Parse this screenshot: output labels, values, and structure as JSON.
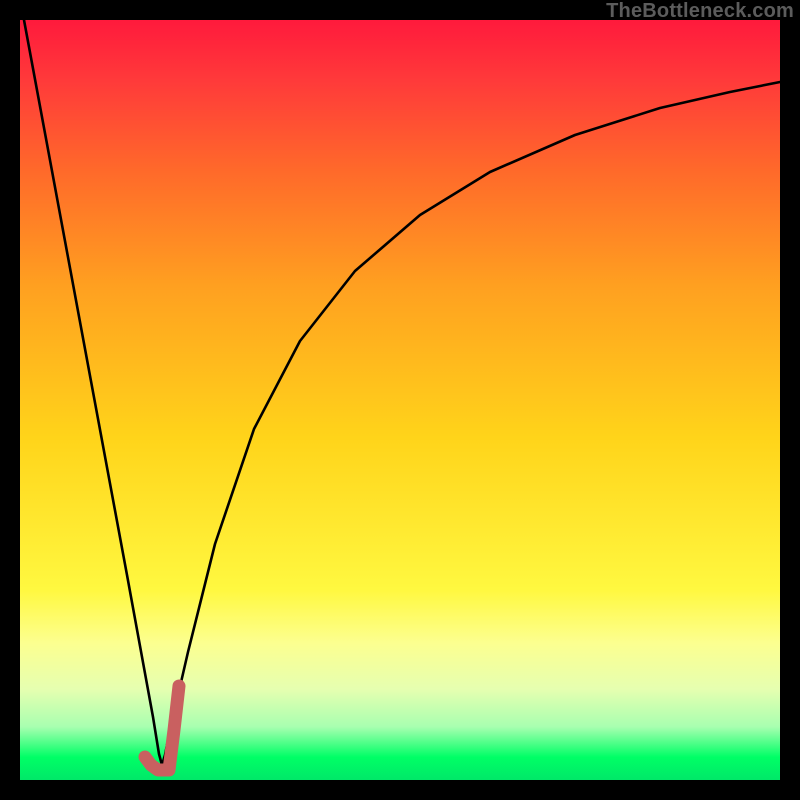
{
  "watermark": {
    "text": "TheBottleneck.com"
  },
  "chart_data": {
    "type": "line",
    "title": "",
    "xlabel": "",
    "ylabel": "",
    "xlim": [
      0,
      100
    ],
    "ylim": [
      0,
      100
    ],
    "grid": false,
    "legend": null,
    "x": [
      0,
      5,
      10,
      15,
      18,
      20,
      22,
      25,
      30,
      35,
      40,
      45,
      50,
      55,
      60,
      70,
      80,
      90,
      100
    ],
    "series": [
      {
        "name": "bottleneck-curve",
        "values": [
          100,
          70,
          41,
          12,
          0,
          6,
          18,
          32,
          47,
          58,
          66,
          72,
          77,
          81,
          84,
          88,
          91,
          92.5,
          93
        ]
      }
    ],
    "highlight": {
      "name": "optimal-region",
      "x": [
        16.4,
        17.2,
        18.2,
        19.6,
        20.3,
        20.9
      ],
      "values": [
        3,
        2,
        1.2,
        1.2,
        6,
        12
      ]
    },
    "background_gradient": {
      "top": "#ff1a3c",
      "middle": "#ffd41a",
      "bottom": "#00e868"
    }
  }
}
